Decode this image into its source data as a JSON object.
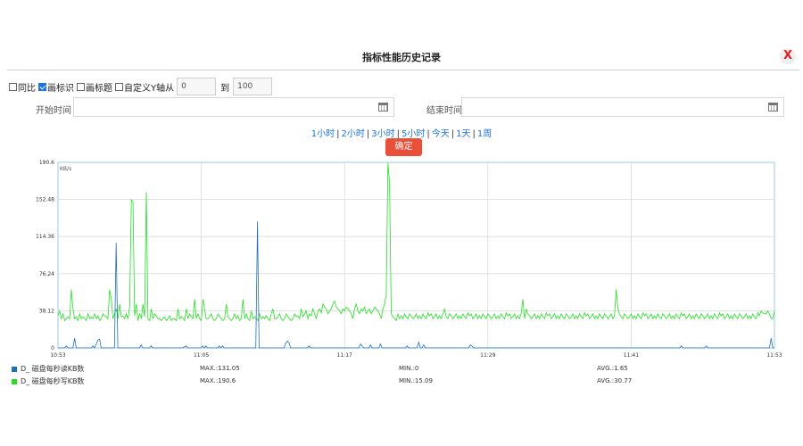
{
  "dialog": {
    "title": "指标性能历史记录",
    "close_label": "X"
  },
  "options": {
    "compare": {
      "label": "同比",
      "checked": false
    },
    "show_marker": {
      "label": "画标识",
      "checked": true
    },
    "show_title": {
      "label": "画标题",
      "checked": false
    },
    "custom_y": {
      "label": "自定义Y轴从",
      "checked": false
    },
    "y_from": "0",
    "to_label": "到",
    "y_to": "100"
  },
  "time": {
    "start_label": "开始时间",
    "start_value": "",
    "end_label": "结束时间",
    "end_value": ""
  },
  "ranges": [
    "1小时",
    "2小时",
    "3小时",
    "5小时",
    "今天",
    "1天",
    "1周"
  ],
  "confirm_label": "确定",
  "colors": {
    "accent": "#1a73e8",
    "confirm": "#e8503a",
    "read": "#1f6fbf",
    "write": "#22e022"
  },
  "chart_data": {
    "type": "line",
    "unit": "KB/s",
    "ylim": [
      0,
      190.6
    ],
    "yticks": [
      "0",
      "38.12",
      "76.24",
      "114.36",
      "152.48",
      "190.6"
    ],
    "xticks": [
      "10:53",
      "11:05",
      "11:17",
      "11:29",
      "11:41",
      "11:53"
    ],
    "x_start": "10:53",
    "x_end": "11:53",
    "grid": true,
    "series": [
      {
        "name": "D_ 磁盘每秒读KB数",
        "color": "#1f6fbf",
        "max": "MAX.:131.05",
        "min": "MIN.:0",
        "avg": "AVG.:1.65",
        "values": [
          0,
          0,
          0,
          0,
          0,
          2,
          0,
          0,
          0,
          0,
          10,
          0,
          0,
          0,
          0,
          0,
          0,
          0,
          0,
          0,
          0,
          2,
          0,
          4,
          8,
          9,
          0,
          0,
          0,
          0,
          0,
          0,
          0,
          0,
          0,
          108,
          0,
          0,
          0,
          0,
          0,
          0,
          0,
          0,
          0,
          0,
          0,
          0,
          0,
          0,
          3,
          0,
          0,
          0,
          0,
          0,
          2,
          0,
          0,
          0,
          0,
          0,
          0,
          0,
          0,
          0,
          0,
          0,
          0,
          0,
          0,
          0,
          0,
          0,
          0,
          0,
          1,
          2,
          0,
          0,
          0,
          0,
          0,
          0,
          0,
          0,
          0,
          2,
          0,
          2,
          0,
          0,
          0,
          0,
          0,
          0,
          0,
          2,
          0,
          2,
          0,
          0,
          0,
          0,
          0,
          0,
          0,
          0,
          0,
          0,
          0,
          0,
          0,
          0,
          0,
          0,
          0,
          0,
          0,
          0,
          130,
          0,
          0,
          0,
          0,
          0,
          0,
          0,
          0,
          0,
          0,
          0,
          0,
          0,
          0,
          0,
          0,
          5,
          7,
          5,
          0,
          0,
          0,
          0,
          0,
          0,
          0,
          0,
          0,
          0,
          0,
          2,
          0,
          0,
          0,
          0,
          0,
          0,
          0,
          0,
          0,
          0,
          0,
          0,
          0,
          0,
          0,
          0,
          0,
          0,
          0,
          0,
          0,
          0,
          0,
          0,
          0,
          0,
          0,
          0,
          0,
          0,
          4,
          2,
          0,
          0,
          0,
          0,
          3,
          0,
          0,
          0,
          0,
          0,
          4,
          0,
          0,
          0,
          0,
          0,
          0,
          0,
          0,
          0,
          0,
          0,
          0,
          0,
          0,
          0,
          2,
          0,
          0,
          0,
          0,
          0,
          0,
          6,
          0,
          0,
          3,
          0,
          0,
          0,
          0,
          0,
          0,
          0,
          0,
          0,
          0,
          0,
          0,
          0,
          0,
          0,
          0,
          0,
          0,
          0,
          0,
          0,
          0,
          0,
          0,
          0,
          0,
          0,
          3,
          2,
          0,
          0,
          0,
          0,
          0,
          0,
          0,
          0,
          0,
          0,
          0,
          0,
          0,
          0,
          0,
          0,
          0,
          0,
          0,
          0,
          0,
          0,
          0,
          0,
          0,
          0,
          0,
          0,
          0,
          0,
          0,
          0,
          0,
          0,
          0,
          0,
          0,
          0,
          0,
          0,
          0,
          0,
          0,
          0,
          0,
          0,
          0,
          0,
          0,
          0,
          0,
          0,
          0,
          0,
          0,
          0,
          0,
          0,
          0,
          0,
          0,
          0,
          0,
          0,
          0,
          0,
          0,
          0,
          0,
          0,
          0,
          0,
          0,
          0,
          0,
          0,
          0,
          0,
          0,
          0,
          0,
          0,
          0,
          0,
          0,
          0,
          0,
          0,
          0,
          0,
          0,
          0,
          0,
          0,
          0,
          0,
          0,
          0,
          0,
          0,
          0,
          0,
          0,
          0,
          0,
          0,
          0,
          0,
          0,
          0,
          0,
          0,
          0,
          0,
          0,
          0,
          0,
          0,
          0,
          0,
          0,
          0,
          0,
          0,
          0,
          2,
          0,
          0,
          0,
          0,
          0,
          0,
          0,
          0,
          0,
          0,
          0,
          0,
          0,
          0,
          2,
          0,
          0,
          0,
          0,
          0,
          0,
          0,
          0,
          0,
          0,
          0,
          0,
          0,
          0,
          0,
          0,
          0,
          0,
          0,
          0,
          0,
          0,
          0,
          0,
          0,
          0,
          0,
          0,
          0,
          0,
          0,
          0,
          0,
          0,
          0,
          0,
          0,
          0,
          10,
          0,
          0
        ]
      },
      {
        "name": "D_ 磁盘每秒写KB数",
        "color": "#22e022",
        "max": "MAX.:190.6",
        "min": "MIN.:15.09",
        "avg": "AVG.:30.77",
        "values": [
          33,
          38,
          30,
          35,
          28,
          30,
          32,
          30,
          60,
          40,
          30,
          32,
          28,
          35,
          30,
          32,
          30,
          28,
          35,
          30,
          32,
          30,
          35,
          30,
          33,
          28,
          30,
          35,
          33,
          32,
          30,
          60,
          50,
          30,
          35,
          40,
          30,
          45,
          32,
          33,
          30,
          35,
          30,
          42,
          152,
          150,
          33,
          45,
          28,
          35,
          30,
          45,
          32,
          160,
          30,
          28,
          40,
          30,
          35,
          33,
          30,
          30,
          28,
          30,
          32,
          28,
          30,
          33,
          28,
          30,
          30,
          28,
          40,
          30,
          32,
          30,
          28,
          40,
          30,
          35,
          32,
          30,
          50,
          30,
          35,
          30,
          28,
          50,
          40,
          30,
          30,
          32,
          35,
          30,
          28,
          30,
          35,
          32,
          30,
          28,
          30,
          45,
          32,
          30,
          28,
          30,
          35,
          30,
          33,
          28,
          30,
          50,
          30,
          35,
          30,
          28,
          38,
          30,
          32,
          30,
          28,
          35,
          30,
          32,
          30,
          33,
          30,
          28,
          35,
          40,
          30,
          30,
          32,
          35,
          30,
          28,
          30,
          35,
          32,
          30,
          28,
          30,
          35,
          32,
          33,
          30,
          40,
          32,
          35,
          38,
          30,
          35,
          33,
          40,
          35,
          30,
          38,
          40,
          36,
          45,
          42,
          40,
          35,
          38,
          40,
          45,
          48,
          42,
          40,
          38,
          35,
          40,
          38,
          42,
          40,
          38,
          35,
          30,
          40,
          45,
          38,
          35,
          40,
          38,
          42,
          35,
          38,
          40,
          35,
          38,
          42,
          40,
          38,
          35,
          30,
          40,
          45,
          55,
          190,
          170,
          35,
          32,
          30,
          28,
          35,
          30,
          33,
          30,
          35,
          32,
          30,
          35,
          33,
          30,
          32,
          35,
          30,
          33,
          30,
          35,
          32,
          30,
          36,
          33,
          35,
          30,
          32,
          35,
          30,
          33,
          30,
          35,
          40,
          32,
          30,
          35,
          33,
          30,
          32,
          35,
          30,
          33,
          30,
          35,
          32,
          30,
          36,
          33,
          35,
          30,
          32,
          35,
          30,
          33,
          30,
          35,
          32,
          30,
          35,
          33,
          30,
          32,
          35,
          30,
          33,
          30,
          35,
          32,
          30,
          36,
          33,
          35,
          30,
          32,
          35,
          30,
          33,
          30,
          35,
          50,
          30,
          40,
          35,
          33,
          30,
          32,
          35,
          30,
          33,
          30,
          35,
          32,
          30,
          36,
          33,
          35,
          30,
          32,
          35,
          30,
          33,
          30,
          35,
          32,
          30,
          35,
          33,
          30,
          32,
          35,
          30,
          33,
          30,
          35,
          32,
          30,
          36,
          33,
          35,
          30,
          32,
          35,
          30,
          33,
          30,
          35,
          32,
          30,
          35,
          33,
          30,
          32,
          35,
          30,
          33,
          60,
          40,
          35,
          32,
          30,
          35,
          33,
          30,
          32,
          35,
          30,
          33,
          30,
          35,
          32,
          30,
          36,
          33,
          35,
          30,
          32,
          35,
          30,
          33,
          30,
          35,
          32,
          30,
          35,
          33,
          30,
          32,
          35,
          30,
          33,
          30,
          35,
          32,
          30,
          36,
          33,
          35,
          30,
          32,
          35,
          30,
          33,
          30,
          35,
          32,
          30,
          35,
          33,
          30,
          32,
          35,
          30,
          33,
          30,
          35,
          32,
          30,
          36,
          33,
          35,
          30,
          32,
          35,
          30,
          33,
          30,
          35,
          32,
          30,
          35,
          33,
          30,
          32,
          35,
          30,
          33,
          30,
          35,
          32,
          30,
          36,
          33,
          38,
          36,
          35,
          35,
          38,
          35,
          30,
          30,
          38
        ]
      }
    ]
  }
}
